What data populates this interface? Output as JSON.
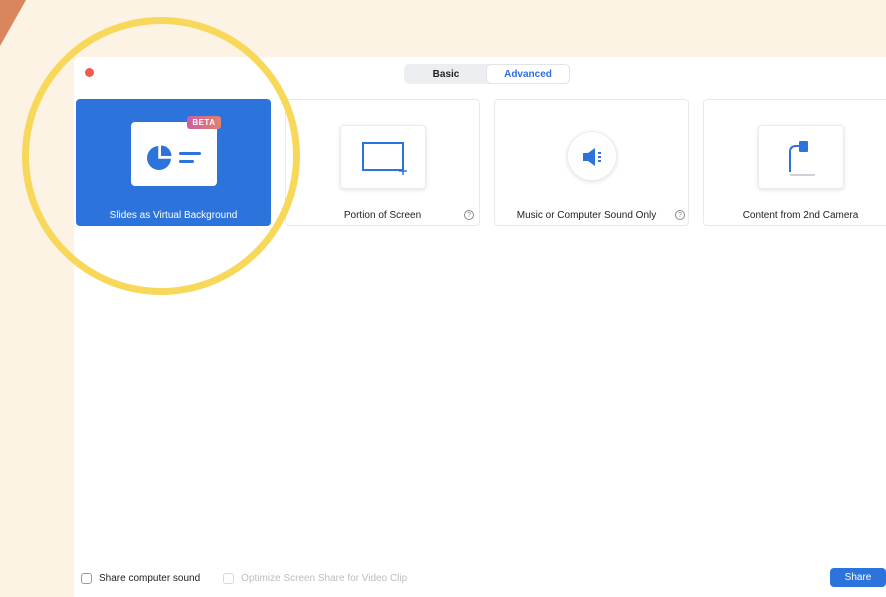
{
  "tabs": [
    {
      "label": "Basic",
      "active": false
    },
    {
      "label": "Advanced",
      "active": true
    }
  ],
  "options": [
    {
      "label": "Slides as Virtual Background",
      "badge": "BETA",
      "selected": true,
      "icon": "slides-pie-icon"
    },
    {
      "label": "Portion of Screen",
      "help": "?",
      "selected": false,
      "icon": "screen-portion-icon"
    },
    {
      "label": "Music or Computer Sound Only",
      "help": "?",
      "selected": false,
      "icon": "speaker-icon"
    },
    {
      "label": "Content from 2nd Camera",
      "help": "?",
      "selected": false,
      "icon": "document-camera-icon"
    }
  ],
  "footer": {
    "share_sound_label": "Share computer sound",
    "optimize_label": "Optimize Screen Share for Video Clip",
    "share_button": "Share"
  },
  "colors": {
    "accent": "#2d73dc",
    "highlight_ring": "#f7d85a",
    "background": "#fdf3e4",
    "close": "#f05a4f"
  }
}
